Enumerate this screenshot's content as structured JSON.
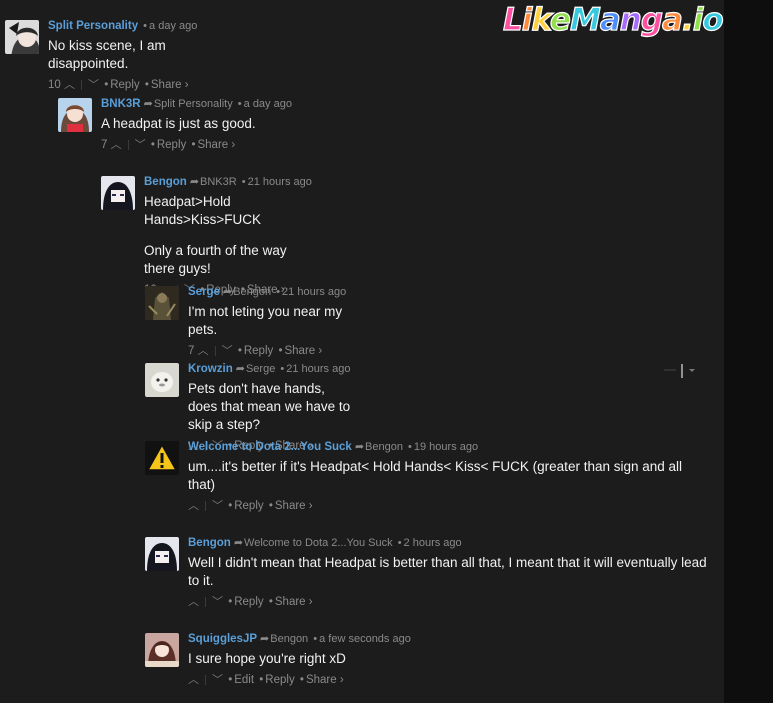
{
  "logo": {
    "text": "LikeManga.io"
  },
  "comments": [
    {
      "author": "Split Personality",
      "time": "a day ago",
      "paragraphs": [
        "No kiss scene, I am disappointed."
      ],
      "votes": "10",
      "actions": [
        "Reply",
        "Share ›"
      ]
    },
    {
      "author": "BNK3R",
      "parent": "Split Personality",
      "time": "a day ago",
      "paragraphs": [
        "A headpat is just as good."
      ],
      "votes": "7",
      "actions": [
        "Reply",
        "Share ›"
      ]
    },
    {
      "author": "Bengon",
      "parent": "BNK3R",
      "time": "21 hours ago",
      "paragraphs": [
        "Headpat>Hold Hands>Kiss>FUCK",
        "Only a fourth of the way there guys!"
      ],
      "votes": "10",
      "actions": [
        "Reply",
        "Share ›"
      ]
    },
    {
      "author": "Serge",
      "parent": "Bengon",
      "time": "21 hours ago",
      "paragraphs": [
        "I'm not leting you near my pets."
      ],
      "votes": "7",
      "actions": [
        "Reply",
        "Share ›"
      ]
    },
    {
      "author": "Krowzin",
      "parent": "Serge",
      "time": "21 hours ago",
      "paragraphs": [
        "Pets don't have hands, does that mean we have to skip a step?"
      ],
      "votes": "",
      "actions": [
        "Reply",
        "Share ›"
      ]
    },
    {
      "author": "Welcome to Dota 2...You Suck",
      "parent": "Bengon",
      "time": "19 hours ago",
      "paragraphs": [
        "um....it's better if it's Headpat< Hold Hands< Kiss< FUCK (greater than sign and all that)"
      ],
      "votes": "",
      "actions": [
        "Reply",
        "Share ›"
      ]
    },
    {
      "author": "Bengon",
      "parent": "Welcome to Dota 2...You Suck",
      "time": "2 hours ago",
      "paragraphs": [
        "Well I didn't mean that Headpat is better than all that, I meant that it will eventually lead to it."
      ],
      "votes": "",
      "actions": [
        "Reply",
        "Share ›"
      ]
    },
    {
      "author": "SquigglesJP",
      "parent": "Bengon",
      "time": "a few seconds ago",
      "paragraphs": [
        "I sure hope you're right xD"
      ],
      "votes": "",
      "actions": [
        "Edit",
        "Reply",
        "Share ›"
      ]
    }
  ],
  "icons": {
    "upvote": "chevron-up-icon",
    "downvote": "chevron-down-icon",
    "in_reply_to": "reply-arrow-icon"
  },
  "colors": {
    "background": "#1c1c1d",
    "author": "#5a9fd8",
    "meta": "#8a8a8a",
    "text": "#f2f2f2"
  }
}
